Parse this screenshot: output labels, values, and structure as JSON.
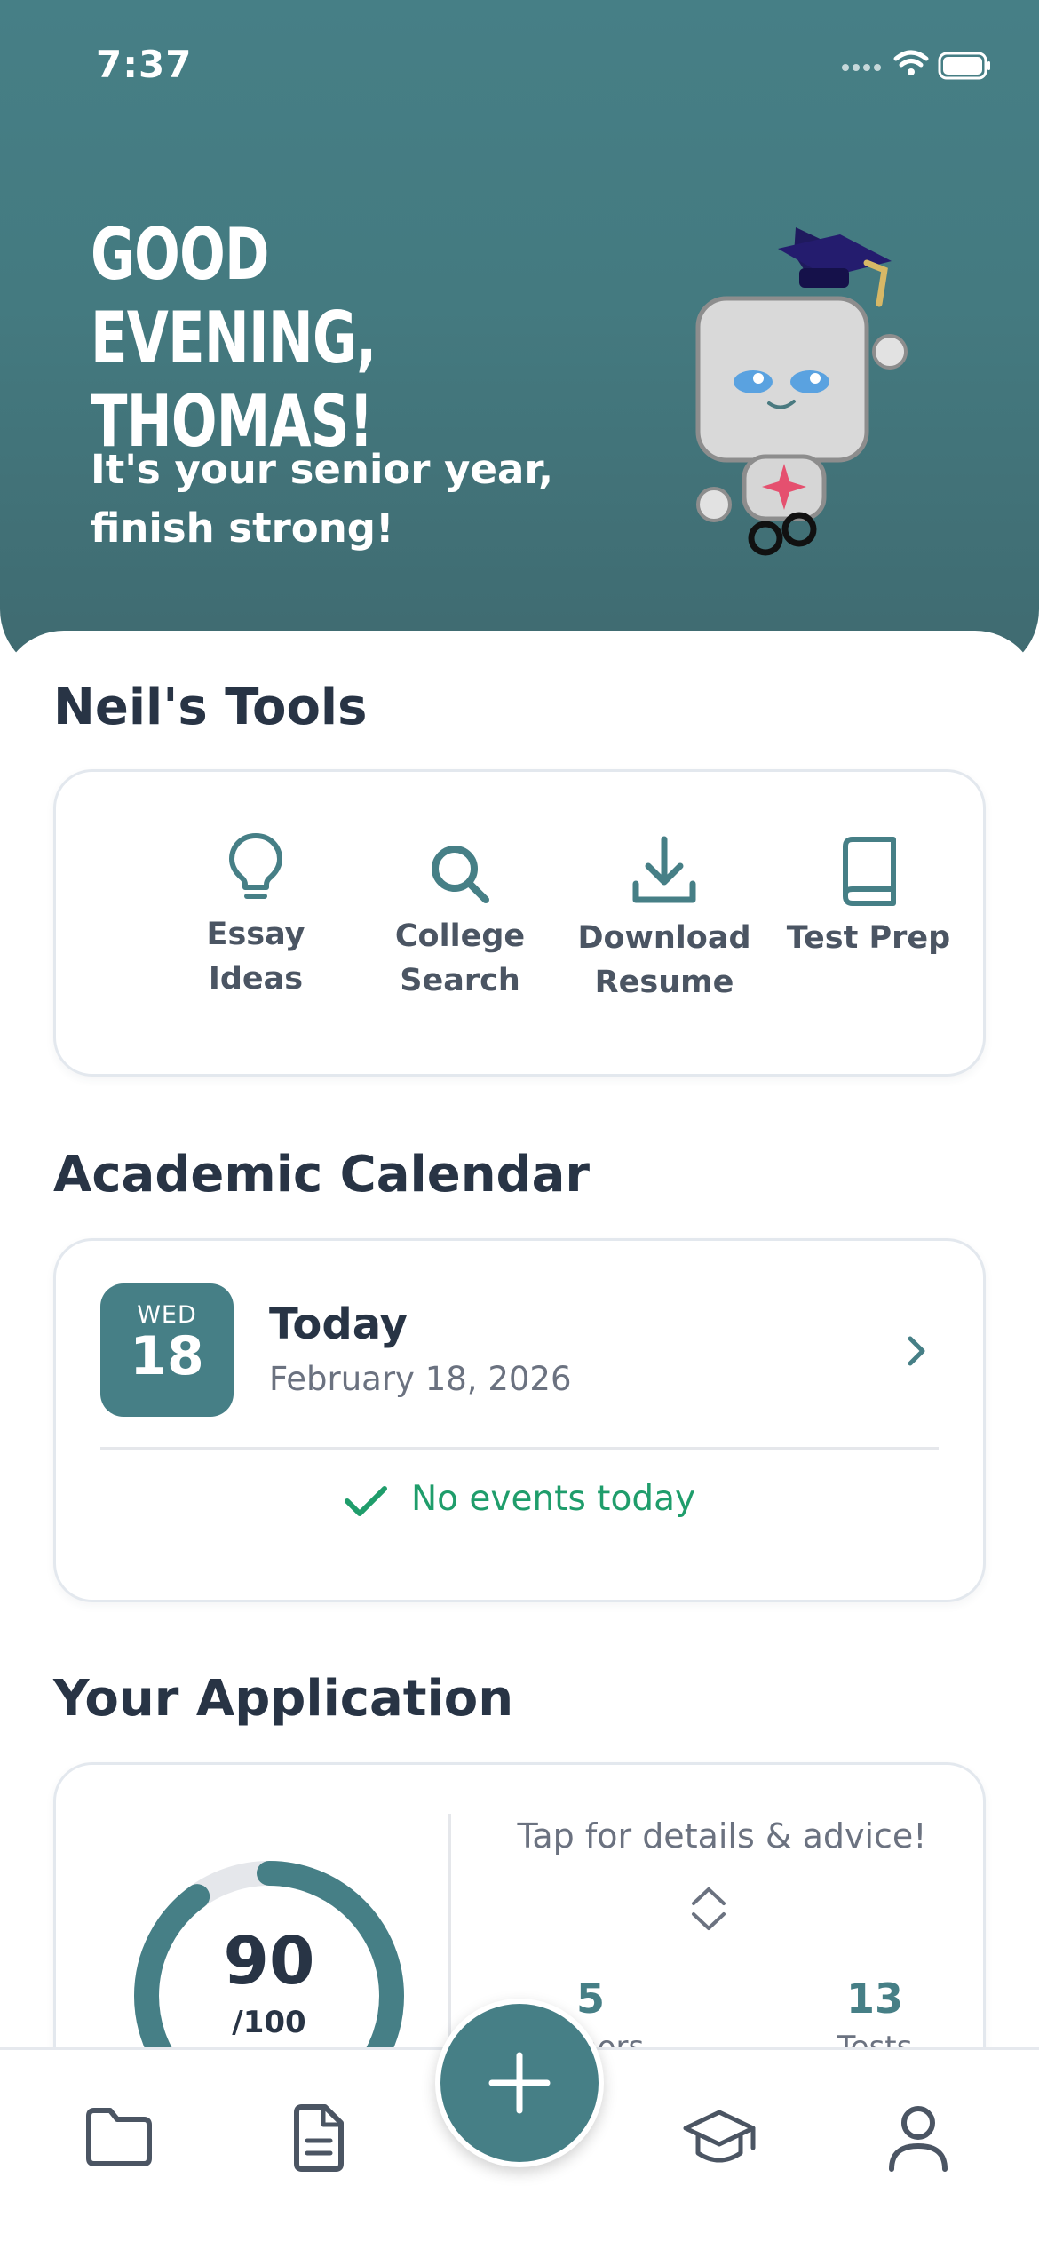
{
  "status_bar": {
    "time": "7:37"
  },
  "hero": {
    "greeting": "GOOD EVENING, THOMAS!",
    "subtitle": "It's your senior year, finish strong!"
  },
  "tools": {
    "title": "Neil's Tools",
    "items": [
      {
        "label": "Essay Ideas",
        "icon": "lightbulb-icon"
      },
      {
        "label": "College Search",
        "icon": "search-icon"
      },
      {
        "label": "Download Resume",
        "icon": "download-icon"
      },
      {
        "label": "Test Prep",
        "icon": "book-icon"
      }
    ]
  },
  "calendar": {
    "title": "Academic Calendar",
    "weekday": "WED",
    "day": "18",
    "heading": "Today",
    "date": "February 18, 2026",
    "empty_text": "No events today"
  },
  "application": {
    "title": "Your Application",
    "score": "90",
    "score_max": "/100",
    "score_fraction": 0.9,
    "tap_text": "Tap for details & advice!",
    "stats": [
      {
        "value": "5",
        "label": "Honors"
      },
      {
        "value": "13",
        "label": "Tests"
      }
    ]
  },
  "tabbar": {
    "items": [
      "folder-icon",
      "document-icon",
      "add-icon",
      "graduation-cap-icon",
      "profile-icon"
    ]
  },
  "colors": {
    "accent": "#467f86",
    "text": "#283445",
    "success": "#1f9d6b"
  }
}
